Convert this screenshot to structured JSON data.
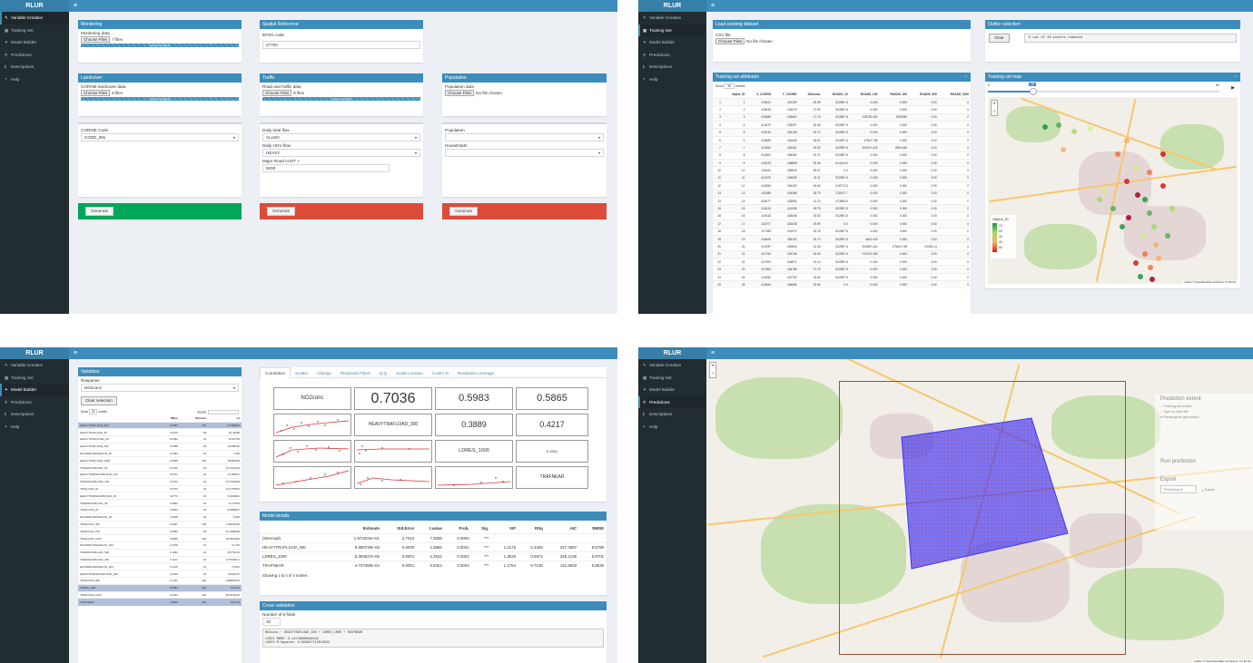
{
  "app": {
    "brand": "RLUR"
  },
  "sidebar": [
    {
      "icon": "wrench-icon",
      "glyph": "✎",
      "label": "Variable Creation"
    },
    {
      "icon": "table-icon",
      "glyph": "▦",
      "label": "Training Set"
    },
    {
      "icon": "model-icon",
      "glyph": "✦",
      "label": "Model Builder"
    },
    {
      "icon": "prediction-icon",
      "glyph": "⚲",
      "label": "Predictions"
    },
    {
      "icon": "info-icon",
      "glyph": "ℹ",
      "label": "Descriptions"
    },
    {
      "icon": "help-icon",
      "glyph": "?",
      "label": "Help"
    }
  ],
  "p1": {
    "monitoring": {
      "title": "Monitoring",
      "label": "Monitoring data",
      "btn": "Choose Files",
      "files": "7 files",
      "progress": "Upload complete"
    },
    "spatial": {
      "title": "Spatial Reference",
      "label": "EPSG code",
      "value": "27700"
    },
    "landcover": {
      "title": "Landcover",
      "label": "CORINE landcover data",
      "btn": "Choose Files",
      "files": "8 files",
      "progress": "Upload complete"
    },
    "traffic": {
      "title": "Traffic",
      "label": "Road and traffic data",
      "btn": "Choose Files",
      "files": "8 files",
      "progress": "Upload complete"
    },
    "population": {
      "title": "Population",
      "label": "Population data",
      "btn": "Choose Files",
      "files": "No file chosen"
    },
    "corine_code": {
      "label": "CORINE Code",
      "value": "CODE_00x"
    },
    "flows": {
      "total_label": "Daily total flow",
      "total_value": "ALLMV",
      "hgv_label": "Daily HGV flow",
      "hgv_value": "HEAVY",
      "aadt_label": "Major Road AADT >",
      "aadt_value": "5000"
    },
    "pop": {
      "pop_label": "Population",
      "hh_label": "Households"
    },
    "generate": "Generate",
    "colors": {
      "green": "#00a65a",
      "red": "#dd4b39"
    }
  },
  "p2": {
    "load": {
      "title": "Load existing dataset",
      "label": "CSV file",
      "btn": "Choose Files",
      "files": "No file chosen"
    },
    "outlier": {
      "title": "Outlier selection",
      "clear": "Clear",
      "status": "0 out of 48 points removed"
    },
    "attrs": {
      "title": "Training set attributes",
      "show": "Show",
      "entries_val": "50",
      "entries": "entries",
      "columns": [
        "",
        "object_ID",
        "X_COORD",
        "Y_COORD",
        "NO2conc",
        "ROADS_10",
        "ROADS_100",
        "ROADS_300",
        "ROADS_500",
        "ROADS_1000"
      ],
      "rows": [
        [
          "1",
          "1",
          "415421",
          "431199",
          "30.08",
          "522897.8",
          "0.000",
          "0.000",
          "0.00",
          "0"
        ],
        [
          "2",
          "2",
          "415518",
          "433276",
          "27.93",
          "522897.8",
          "0.000",
          "0.000",
          "0.00",
          "0"
        ],
        [
          "3",
          "3",
          "415385",
          "433502",
          "17.75",
          "522897.8",
          "215730.432",
          "1996330",
          "0.00",
          "0"
        ],
        [
          "4",
          "4",
          "414279",
          "433297",
          "30.08",
          "522897.8",
          "0.000",
          "0.000",
          "0.00",
          "0"
        ],
        [
          "5",
          "5",
          "415743",
          "434108",
          "33.74",
          "522897.8",
          "0.000",
          "0.000",
          "0.00",
          "0"
        ],
        [
          "6",
          "6",
          "415580",
          "433428",
          "35.61",
          "522897.8",
          "47602.798",
          "0.000",
          "0.00",
          "0"
        ],
        [
          "7",
          "7",
          "414351",
          "434431",
          "20.53",
          "522897.8",
          "209071.413",
          "2994.436",
          "0.00",
          "0"
        ],
        [
          "8",
          "8",
          "414502",
          "435084",
          "32.71",
          "522897.8",
          "0.000",
          "0.000",
          "0.00",
          "0"
        ],
        [
          "9",
          "9",
          "415123",
          "435808",
          "29.45",
          "614144.5",
          "0.000",
          "0.000",
          "0.00",
          "0"
        ],
        [
          "10",
          "10",
          "416411",
          "435926",
          "30.07",
          "0.0",
          "0.000",
          "0.000",
          "0.00",
          "0"
        ],
        [
          "11",
          "11",
          "412373",
          "434536",
          "32.11",
          "522897.8",
          "0.000",
          "0.000",
          "0.00",
          "0"
        ],
        [
          "12",
          "12",
          "416352",
          "434433",
          "34.54",
          "618772.5",
          "0.000",
          "0.000",
          "0.00",
          "0"
        ],
        [
          "13",
          "13",
          "411589",
          "434468",
          "28.79",
          "215107.7",
          "0.000",
          "0.000",
          "0.00",
          "0"
        ],
        [
          "14",
          "14",
          "416277",
          "433954",
          "31.13",
          "473509.8",
          "0.000",
          "0.000",
          "0.00",
          "0"
        ],
        [
          "15",
          "15",
          "412413",
          "431308",
          "28.75",
          "522897.8",
          "0.000",
          "0.000",
          "0.00",
          "0"
        ],
        [
          "16",
          "16",
          "415133",
          "435448",
          "33.53",
          "522897.8",
          "0.000",
          "0.000",
          "0.00",
          "0"
        ],
        [
          "17",
          "17",
          "411977",
          "432038",
          "29.99",
          "0.0",
          "0.000",
          "0.000",
          "0.00",
          "0"
        ],
        [
          "18",
          "18",
          "417383",
          "431972",
          "32.78",
          "522897.8",
          "0.000",
          "0.000",
          "0.00",
          "0"
        ],
        [
          "19",
          "19",
          "416406",
          "436192",
          "30.73",
          "522897.8",
          "4814.418",
          "0.000",
          "0.00",
          "0"
        ],
        [
          "20",
          "20",
          "413787",
          "432818",
          "31.46",
          "522897.8",
          "305087.442",
          "179444.738",
          "20053.14",
          "0"
        ],
        [
          "21",
          "21",
          "417754",
          "433735",
          "30.63",
          "522897.8",
          "210074.436",
          "0.000",
          "0.00",
          "0"
        ],
        [
          "22",
          "22",
          "417924",
          "434874",
          "31.14",
          "522897.8",
          "0.000",
          "0.000",
          "0.00",
          "0"
        ],
        [
          "23",
          "23",
          "417651",
          "434758",
          "37.79",
          "522897.8",
          "0.000",
          "0.000",
          "0.00",
          "0"
        ],
        [
          "24",
          "24",
          "414932",
          "437753",
          "33.53",
          "522897.8",
          "0.000",
          "0.000",
          "0.00",
          "0"
        ],
        [
          "25",
          "25",
          "415264",
          "436656",
          "23.94",
          "0.0",
          "0.000",
          "0.000",
          "0.00",
          "0"
        ]
      ]
    },
    "map": {
      "title": "Training set map",
      "slider_min": "0",
      "slider_val": "18",
      "slider_max": "50",
      "legend_title": "Object_ID",
      "legend": [
        "10",
        "20",
        "30",
        "40",
        "50"
      ],
      "attribution": "Leaflet | © OpenStreetMap contributors, CC-BY-SA"
    }
  },
  "p3": {
    "variables": {
      "title": "Variables",
      "response_label": "Response",
      "response": "NO2conc",
      "clear": "Clear selection",
      "show": "Show",
      "entries_val": "25",
      "entries": "entries",
      "search": "Search:",
      "columns": [
        "",
        "RMse",
        "Variance",
        "sd"
      ],
      "rows": [
        [
          "HEAVYTRAFLOAD_300",
          "0.5983",
          "100",
          "0.6499991"
        ],
        [
          "HEAVYTRAFLOAD_50",
          "0.0479",
          "98",
          "81.42195"
        ],
        [
          "HEAVYTRAFFLOAD_50",
          "0.0481",
          "34",
          "8.014730"
        ],
        [
          "HEAVYTRAFLOAD_100",
          "0.0488",
          "93",
          "10.658149"
        ],
        [
          "MAJORROADLENGTH_50",
          "0.0493",
          "34",
          "7.252"
        ],
        [
          "HEAVYTRAFLOAD_1000",
          "0.0595",
          "100",
          "18.853439"
        ],
        [
          "TRAFMAJORLOAD_50",
          "0.0730",
          "34",
          "10.7021123"
        ],
        [
          "HEAVYTRAFMAJORLOAD_100",
          "0.0731",
          "24",
          "12.080011"
        ],
        [
          "TRAFMAJORLOAD_100",
          "0.0732",
          "24",
          "27.5726549"
        ],
        [
          "TRAFLOAD_50",
          "0.0743",
          "34",
          "12.4779531"
        ],
        [
          "HEAVYTRAFMAJORLOAD_25",
          "0.0773",
          "24",
          "6.1834842"
        ],
        [
          "TRAFMAJORLOAD_25",
          "0.0804",
          "24",
          "8.177546"
        ],
        [
          "TRAFLOAD_25",
          "0.0843",
          "34",
          "8.4938927"
        ],
        [
          "MAJORROADLENGTH_25",
          "0.0908",
          "24",
          "6.618"
        ],
        [
          "TRAFLOAD_300",
          "0.0947",
          "100",
          "1.02078410"
        ],
        [
          "TRAFLOAD_100",
          "0.0953",
          "93",
          "10.2308245"
        ],
        [
          "TRAFLOAD_1000",
          "0.0965",
          "100",
          "46.5811920"
        ],
        [
          "MAJORROADLENGTH_100",
          "0.1078",
          "24",
          "14.742"
        ],
        [
          "TRAFMAJORLOAD_500",
          "0.1094",
          "24",
          "267795.34"
        ],
        [
          "TRAFMAJORLOAD_300",
          "0.1121",
          "24",
          "17733800.1"
        ],
        [
          "MAJORROADLENGTH_300",
          "0.1215",
          "24",
          "73.621"
        ],
        [
          "HEAVYTRAFMAJORLOAD_500",
          "0.1229",
          "24",
          "18126167"
        ],
        [
          "TRAFLOAD_500",
          "0.1241",
          "100",
          "21688180.5"
        ],
        [
          "LDRES_1000",
          "0.5983",
          "100",
          "70.1213"
        ],
        [
          "TRAFLOAD_1000",
          "0.2401",
          "100",
          "8274158.62"
        ],
        [
          "TRAFNEAR",
          "0.5865",
          "100",
          "106.170"
        ]
      ],
      "selected": [
        0,
        23,
        25
      ]
    },
    "tabs": [
      "Correlation",
      "Scatter",
      "Change",
      "Residuals-Fitted",
      "Q-Q",
      "Scale-Location",
      "Cook's D",
      "Residuals-Leverage"
    ],
    "corr": {
      "vars": [
        "NO2conc",
        "HEAVYTRAFLOAD_300",
        "LDRES_1000",
        "TRAFNEAR"
      ],
      "r12": "0.7036",
      "r13": "0.5983",
      "r14": "0.5865",
      "r23": "0.3889",
      "r24": "0.4217",
      "r34": "0.1961"
    },
    "details": {
      "title": "Model details",
      "columns": [
        "",
        "Estimate",
        "Std.Error",
        "t.value",
        "Prob.",
        "Sig.",
        "VIF",
        "RSq",
        "AIC",
        "RMSE"
      ],
      "rows": [
        [
          "(Intercept)",
          "1.973204e+01",
          "2.7010",
          "7.3055",
          "0.0000",
          "***",
          "",
          "",
          "",
          ""
        ],
        [
          "HEAVYTRAFLOAD_300",
          "8.980749e-06",
          "0.0000",
          "4.3856",
          "0.0001",
          "***",
          "1.2175",
          "0.3439",
          "347.3387",
          "8.6798"
        ],
        [
          "LDRES_1000",
          "5.393627e-06",
          "0.0001",
          "4.2531",
          "0.0001",
          "***",
          "1.3626",
          "0.5972",
          "326.2136",
          "6.9701"
        ],
        [
          "TRAFNEAR",
          "4.737368e-04",
          "0.0001",
          "3.8324",
          "0.0004",
          "***",
          "1.1754",
          "0.7146",
          "311.6833",
          "5.8539"
        ]
      ],
      "footer": "Showing 1 to 4 of 4 entries"
    },
    "cv": {
      "title": "Cross validation",
      "folds_label": "Number of k-folds",
      "folds": "10",
      "formula": "NO2conc ~ HEAVYTRAFLOAD_300 + LDRES_1000 + TRAFNEAR",
      "out1": "LOOCV RMSE: 6.14736085646182",
      "out2": "LOOCV R-Squared: 0.659847712012815"
    }
  },
  "p4": {
    "panel": {
      "extent_title": "Prediction extent",
      "opt1": "Training set extent",
      "opt2": "Type in point file",
      "opt3": "Rectangular grid shape",
      "run_title": "Run prediction",
      "export_title": "Export",
      "export_value": "Prediction",
      "export_btn": "Export"
    },
    "attribution": "Leaflet | © OpenStreetMap contributors, CC-BY-SA",
    "polygon_color": "#3b35ff"
  }
}
